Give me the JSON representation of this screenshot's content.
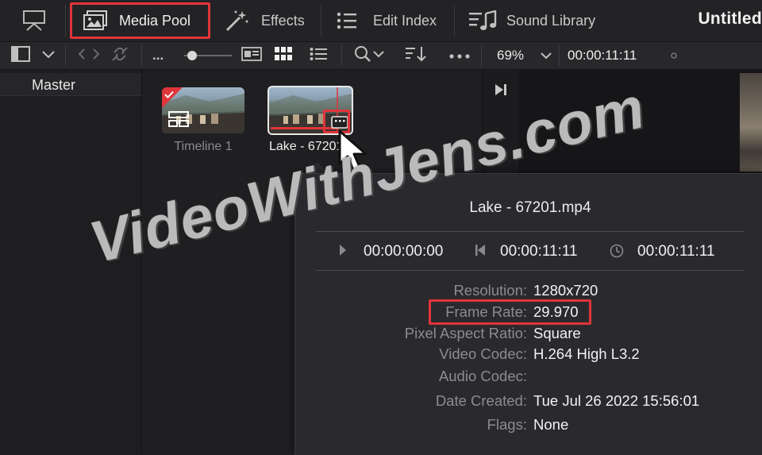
{
  "topbar": {
    "items": [
      {
        "label": "Media Pool",
        "icon": "media-pool-icon"
      },
      {
        "label": "Effects",
        "icon": "magic-wand-icon"
      },
      {
        "label": "Edit Index",
        "icon": "list-icon"
      },
      {
        "label": "Sound Library",
        "icon": "music-note-icon"
      }
    ],
    "title": "Untitled"
  },
  "toolbar": {
    "more_label": "...",
    "zoom": "69%",
    "timecode": "00:00:11:11"
  },
  "sidebar": {
    "master_label": "Master"
  },
  "pool": {
    "clips": [
      {
        "label": "Timeline 1"
      },
      {
        "label": "Lake - 67201.mp4"
      }
    ]
  },
  "popup": {
    "title": "Lake - 67201.mp4",
    "timecodes": [
      "00:00:00:00",
      "00:00:11:11",
      "00:00:11:11"
    ],
    "rows": [
      {
        "label": "Resolution:",
        "value": "1280x720"
      },
      {
        "label": "Frame Rate:",
        "value": "29.970"
      },
      {
        "label": "Pixel Aspect Ratio:",
        "value": "Square"
      },
      {
        "label": "Video Codec:",
        "value": "H.264 High L3.2"
      },
      {
        "label": "Audio Codec:",
        "value": ""
      },
      {
        "label": "Date Created:",
        "value": "Tue Jul 26 2022 15:56:01"
      },
      {
        "label": "Flags:",
        "value": "None"
      }
    ]
  },
  "watermark": "VideoWithJens.com",
  "colors": {
    "highlight": "#e0353b",
    "accent": "#e0353b"
  }
}
